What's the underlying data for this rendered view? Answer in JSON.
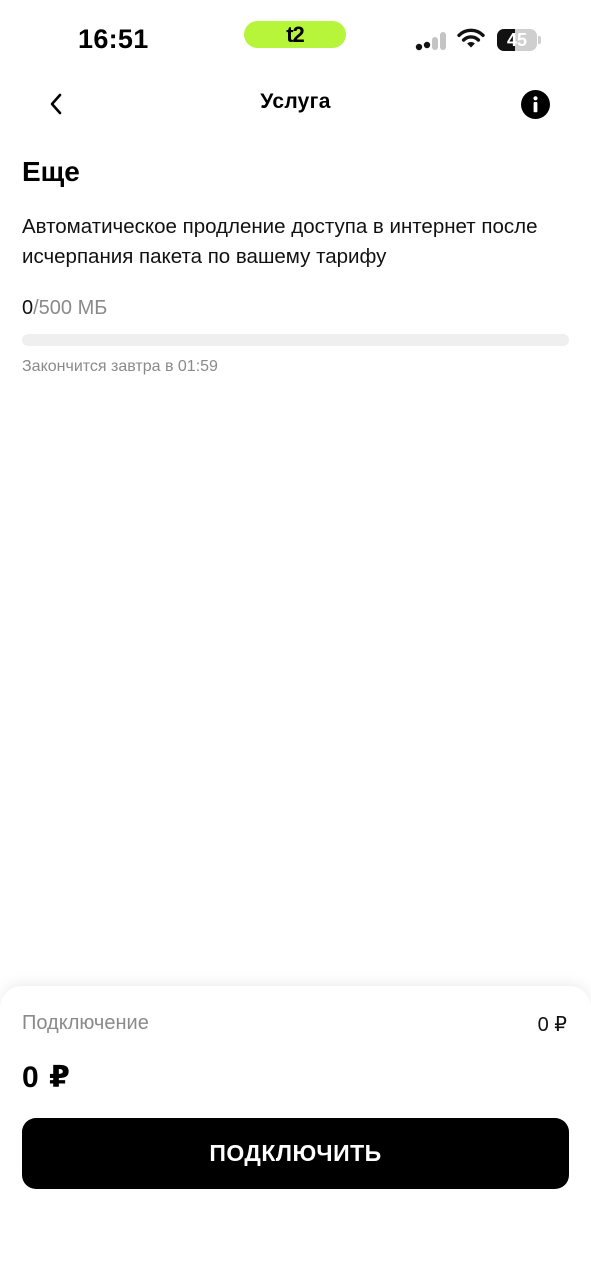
{
  "status_bar": {
    "time": "16:51",
    "carrier": "t2",
    "carrier_color": "#b7f53a",
    "battery_percent": "45",
    "battery_level": 0.45,
    "signal_bars_active": 2,
    "signal_bars_total": 4
  },
  "nav": {
    "back_icon": "chevron-left-icon",
    "title": "Услуга",
    "info_icon": "info-icon"
  },
  "service": {
    "title": "Еще",
    "description": "Автоматическое продление доступа в интернет после исчерпания пакета по вашему тарифу",
    "usage_used": "0",
    "usage_total": "/500 МБ",
    "usage_fraction": 0,
    "expires": "Закончится завтра в 01:59"
  },
  "bottom": {
    "connection_label": "Подключение",
    "connection_price": "0 ₽",
    "total_price": "0 ₽",
    "connect_button": "ПОДКЛЮЧИТЬ"
  }
}
